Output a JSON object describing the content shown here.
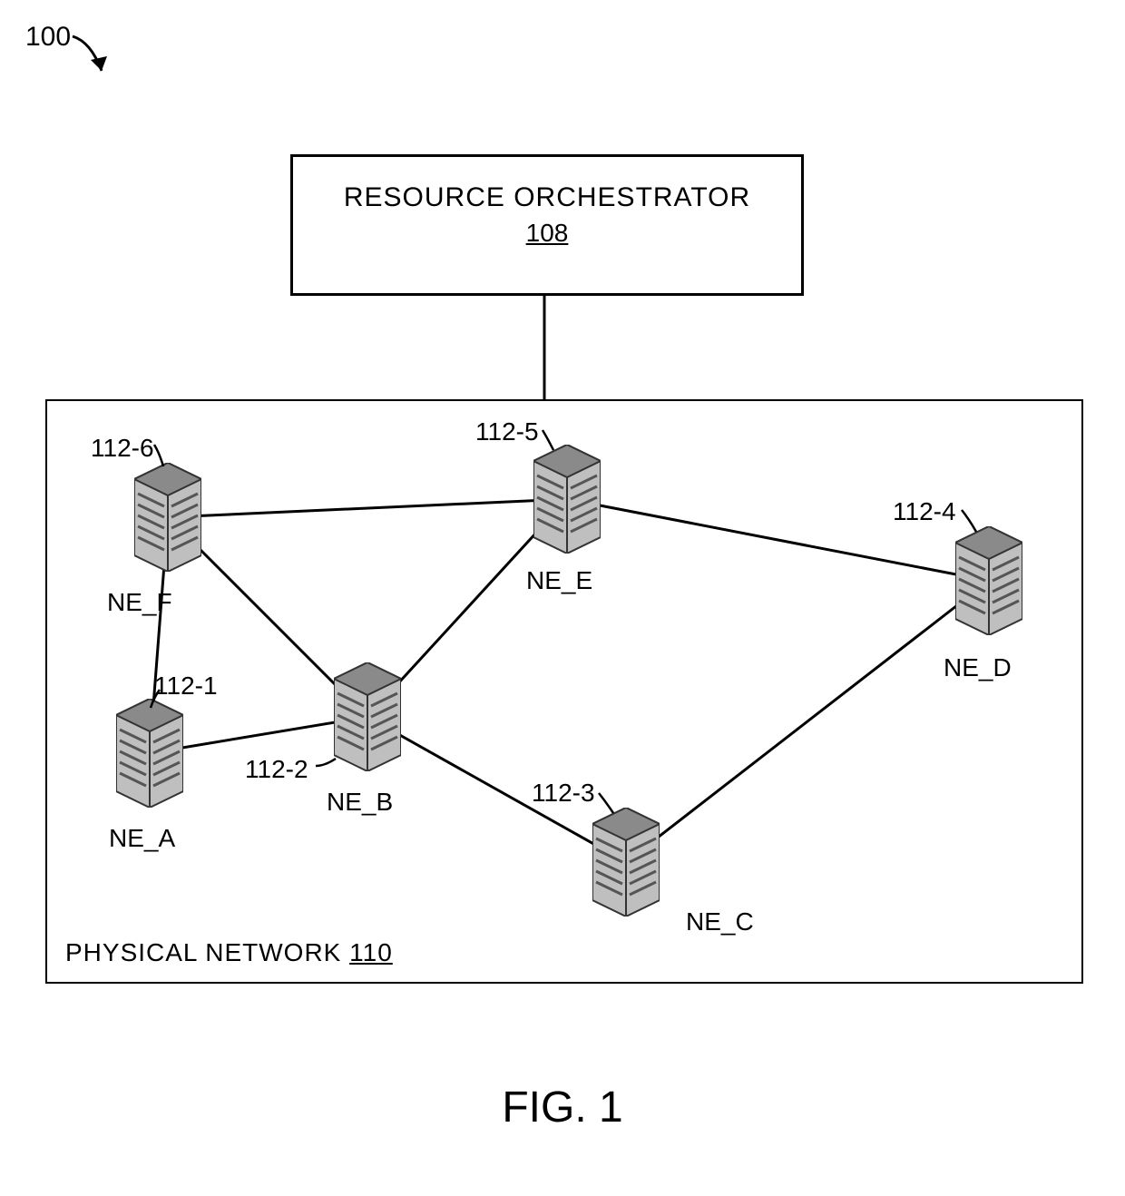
{
  "figure": {
    "system_ref": "100",
    "caption": "FIG. 1",
    "orchestrator": {
      "label": "RESOURCE ORCHESTRATOR",
      "ref": "108"
    },
    "network": {
      "label": "PHYSICAL NETWORK",
      "ref": "110"
    },
    "nodes": {
      "A": {
        "name": "NE_A",
        "ref": "112-1"
      },
      "B": {
        "name": "NE_B",
        "ref": "112-2"
      },
      "C": {
        "name": "NE_C",
        "ref": "112-3"
      },
      "D": {
        "name": "NE_D",
        "ref": "112-4"
      },
      "E": {
        "name": "NE_E",
        "ref": "112-5"
      },
      "F": {
        "name": "NE_F",
        "ref": "112-6"
      }
    },
    "edges": [
      [
        "F",
        "E"
      ],
      [
        "E",
        "D"
      ],
      [
        "E",
        "B"
      ],
      [
        "F",
        "B"
      ],
      [
        "F",
        "A"
      ],
      [
        "A",
        "B"
      ],
      [
        "B",
        "C"
      ],
      [
        "C",
        "D"
      ]
    ]
  }
}
